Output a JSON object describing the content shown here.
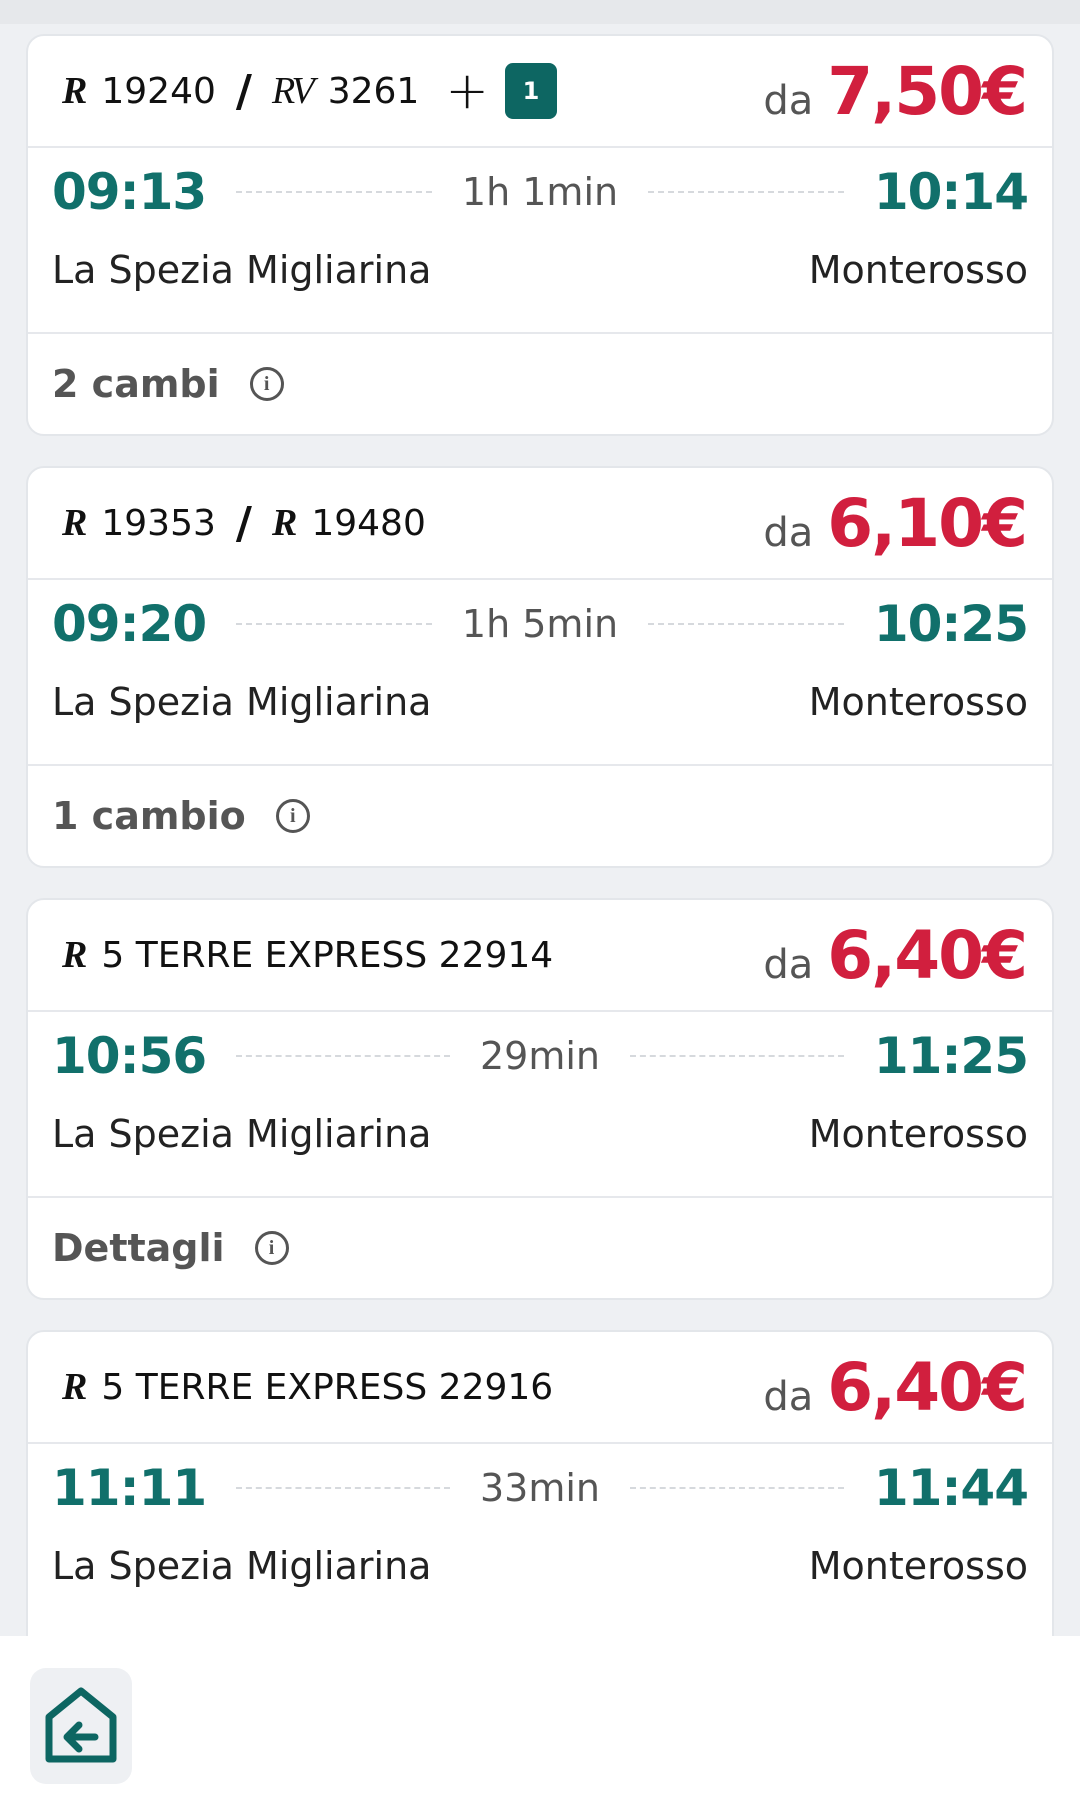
{
  "colors": {
    "time": "#11706b",
    "price": "#d11f3e",
    "badge": "#0d6662",
    "home_icon": "#0d6662"
  },
  "results": [
    {
      "trains": [
        {
          "logo": "R",
          "number": "19240"
        },
        {
          "logo": "RV",
          "number": "3261"
        }
      ],
      "extra": {
        "plus": "+",
        "badge": "1"
      },
      "price_prefix": "da",
      "price": "7,50€",
      "depart_time": "09:13",
      "duration": "1h 1min",
      "arrive_time": "10:14",
      "from": "La Spezia Migliarina",
      "to": "Monterosso",
      "footer": "2 cambi"
    },
    {
      "trains": [
        {
          "logo": "R",
          "number": "19353"
        },
        {
          "logo": "R",
          "number": "19480"
        }
      ],
      "price_prefix": "da",
      "price": "6,10€",
      "depart_time": "09:20",
      "duration": "1h 5min",
      "arrive_time": "10:25",
      "from": "La Spezia Migliarina",
      "to": "Monterosso",
      "footer": "1 cambio"
    },
    {
      "trains": [
        {
          "logo": "R",
          "number": "5 TERRE EXPRESS 22914"
        }
      ],
      "price_prefix": "da",
      "price": "6,40€",
      "depart_time": "10:56",
      "duration": "29min",
      "arrive_time": "11:25",
      "from": "La Spezia Migliarina",
      "to": "Monterosso",
      "footer": "Dettagli"
    },
    {
      "trains": [
        {
          "logo": "R",
          "number": "5 TERRE EXPRESS 22916"
        }
      ],
      "price_prefix": "da",
      "price": "6,40€",
      "depart_time": "11:11",
      "duration": "33min",
      "arrive_time": "11:44",
      "from": "La Spezia Migliarina",
      "to": "Monterosso"
    }
  ],
  "icons": {
    "info": "info-circle-icon",
    "home": "home-exit-icon"
  }
}
